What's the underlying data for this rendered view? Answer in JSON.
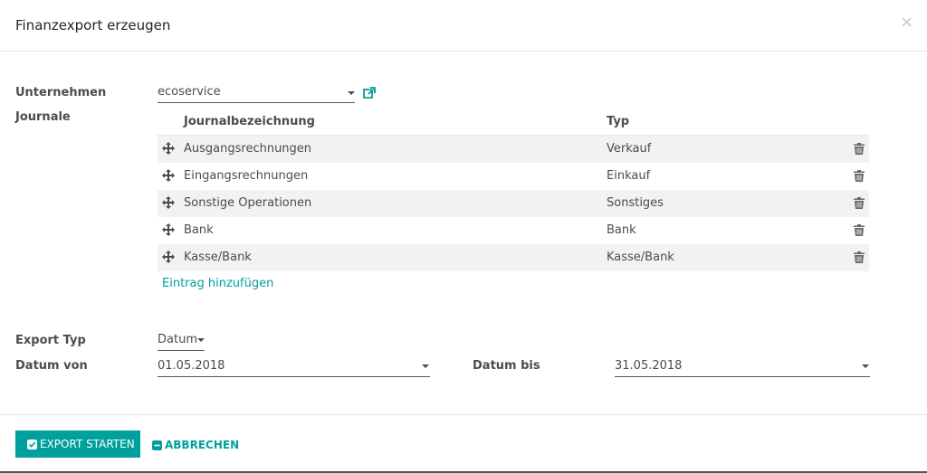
{
  "dialog": {
    "title": "Finanzexport erzeugen",
    "close_symbol": "×"
  },
  "company": {
    "label": "Unternehmen",
    "value": "ecoservice",
    "dropdown_icon": "caret-down-icon",
    "external_icon": "external-link-icon"
  },
  "journals": {
    "label": "Journale",
    "columns": [
      "Journalbezeichnung",
      "Typ"
    ],
    "rows": [
      {
        "name": "Ausgangsrechnungen",
        "type": "Verkauf"
      },
      {
        "name": "Eingangsrechnungen",
        "type": "Einkauf"
      },
      {
        "name": "Sonstige Operationen",
        "type": "Sonstiges"
      },
      {
        "name": "Bank",
        "type": "Bank"
      },
      {
        "name": "Kasse/Bank",
        "type": "Kasse/Bank"
      }
    ],
    "add_label": "Eintrag hinzufügen"
  },
  "export_type": {
    "label": "Export Typ",
    "value": "Datum"
  },
  "date_from": {
    "label": "Datum von",
    "value": "01.05.2018"
  },
  "date_to": {
    "label": "Datum bis",
    "value": "31.05.2018"
  },
  "footer": {
    "primary_label": "EXPORT STARTEN",
    "cancel_label": "ABBRECHEN"
  },
  "colors": {
    "accent": "#00a09d",
    "row_stripe": "#f2f2f2"
  }
}
